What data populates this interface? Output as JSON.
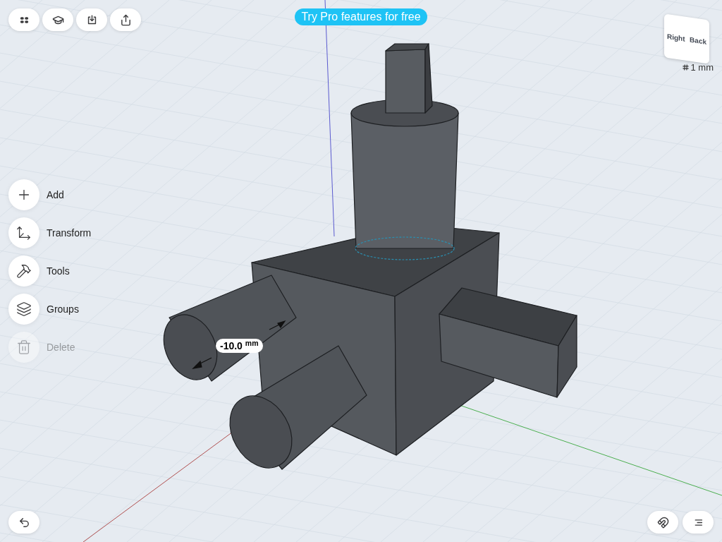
{
  "top_toolbar": [
    {
      "kind": "grid"
    },
    {
      "kind": "learn"
    },
    {
      "kind": "import"
    },
    {
      "kind": "export"
    }
  ],
  "promo_banner": {
    "label": "Try Pro features for free"
  },
  "view_cube": {
    "faces": [
      "Right",
      "Back"
    ]
  },
  "grid_size": {
    "label": "1 mm"
  },
  "side_menu": [
    {
      "kind": "add",
      "label": "Add",
      "disabled": false
    },
    {
      "kind": "transform",
      "label": "Transform",
      "disabled": false
    },
    {
      "kind": "tools",
      "label": "Tools",
      "disabled": false
    },
    {
      "kind": "groups",
      "label": "Groups",
      "disabled": false
    },
    {
      "kind": "delete",
      "label": "Delete",
      "disabled": true
    }
  ],
  "dimension": {
    "value": "-10.0 $^{mm}$"
  },
  "bottom_left": [
    {
      "kind": "undo"
    }
  ],
  "bottom_right": [
    {
      "kind": "snap"
    },
    {
      "kind": "list"
    }
  ]
}
